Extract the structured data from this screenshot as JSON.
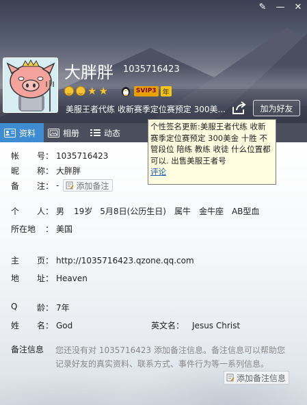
{
  "window": {
    "buttons": [
      {
        "name": "skin-icon",
        "glyph": "✎"
      },
      {
        "name": "minimize-icon",
        "glyph": "—"
      },
      {
        "name": "close-icon",
        "glyph": "✕"
      }
    ]
  },
  "profile": {
    "nickname": "大胖胖",
    "qq_number": "1035716423",
    "vip_label": "SVIP3",
    "vip_year": "年",
    "signature_short": "美服王者代练 收新赛季定位赛预定 300美...",
    "add_friend_label": "加为好友"
  },
  "tabs": [
    {
      "label": "资料",
      "icon": "id-card-icon",
      "active": true
    },
    {
      "label": "相册",
      "icon": "photo-icon",
      "active": false
    },
    {
      "label": "动态",
      "icon": "feed-icon",
      "active": false
    }
  ],
  "tooltip": {
    "text": "个性签名更新:美服王者代练 收新赛季定位赛预定 300美金 十胜 不管段位 陪练 教练 收徒 什么位置都可以. 出售美服王者号",
    "link": "评论"
  },
  "info": {
    "account_label": [
      "帐",
      "号："
    ],
    "account_value": "1035716423",
    "nick_label": [
      "昵",
      "称："
    ],
    "nick_value": "大胖胖",
    "remark_label": [
      "备",
      "注："
    ],
    "remark_value": "-",
    "add_remark_label": "添加备注",
    "personal_label": [
      "个",
      "人："
    ],
    "gender": "男",
    "age": "19岁",
    "birthday": "5月8日(公历生日)",
    "zodiac_cn": "属牛",
    "zodiac": "金牛座",
    "blood": "AB型血",
    "location_label": [
      "所在地",
      "："
    ],
    "location_value": "美国",
    "homepage_label": [
      "主",
      "页："
    ],
    "homepage_value": "http://1035716423.qzone.qq.com",
    "address_label": [
      "地",
      "址："
    ],
    "address_value": "Heaven",
    "qage_label": [
      "Q",
      "龄："
    ],
    "qage_value": "7年",
    "name_label": [
      "姓",
      "名："
    ],
    "name_value": "God",
    "en_name_label": "英文名：",
    "en_name_value": "Jesus Christ",
    "note_info_label": "备注信息",
    "note_info_desc": "您还没有对 1035716423 添加备注信息。备注信息可以帮助您记录好友的真实资料、联系方式、事件行为等一系列信息。",
    "add_note_info_label": "添加备注信息"
  },
  "colors": {
    "tab_active": "#3e8cd1",
    "link": "#1a5fb4",
    "tooltip_bg": "#fffee1"
  }
}
